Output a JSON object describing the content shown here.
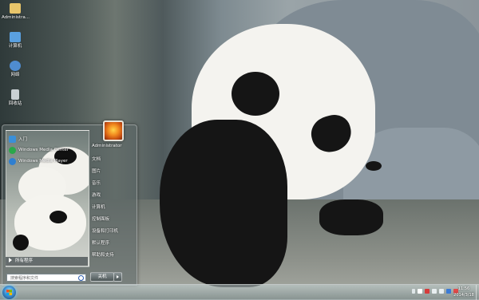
{
  "desktop": {
    "icons": [
      {
        "label": "Administra...",
        "icon": "user-folder-icon",
        "color": "#e8c56a"
      },
      {
        "label": "计算机",
        "icon": "computer-icon",
        "color": "#5aa0e0"
      },
      {
        "label": "网络",
        "icon": "network-icon",
        "color": "#4f8cd0"
      },
      {
        "label": "回收站",
        "icon": "recycle-bin-icon",
        "color": "#c9d0d4"
      }
    ]
  },
  "start_menu": {
    "pinned": [
      {
        "label": "入门",
        "icon": "getting-started-icon",
        "color": "#3a8fd8"
      },
      {
        "label": "Windows Media Center",
        "icon": "media-center-icon",
        "color": "#2aa84a"
      },
      {
        "label": "Windows Media Player",
        "icon": "media-player-icon",
        "color": "#2f7fd0"
      }
    ],
    "all_programs": "所有程序",
    "search_placeholder": "搜索程序和文件",
    "user_name": "Administrator",
    "right_items": [
      "文档",
      "图片",
      "音乐",
      "游戏",
      "计算机",
      "控制面板",
      "设备和打印机",
      "默认程序",
      "帮助和支持"
    ],
    "shutdown_label": "关机"
  },
  "taskbar": {
    "time": "11:56",
    "date": "2014/3/18",
    "tray_icons": [
      {
        "icon": "chevron-up-icon",
        "color": "#dfe6e8"
      },
      {
        "icon": "flag-icon",
        "color": "#ffffff"
      },
      {
        "icon": "security-icon",
        "color": "#d63b3b"
      },
      {
        "icon": "network-icon",
        "color": "#e8eef0"
      },
      {
        "icon": "volume-icon",
        "color": "#e8eef0"
      },
      {
        "icon": "app-icon",
        "color": "#3b7bd6"
      },
      {
        "icon": "app-icon",
        "color": "#e24a4a"
      }
    ]
  }
}
